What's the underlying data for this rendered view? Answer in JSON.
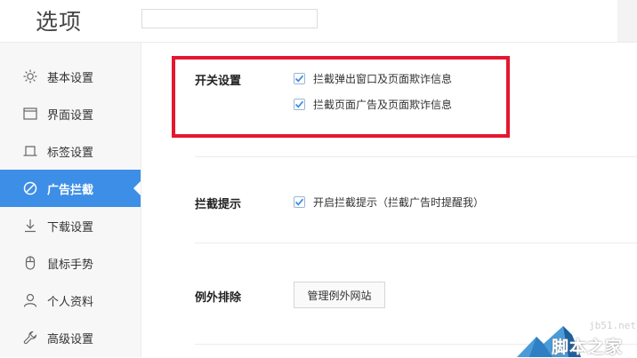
{
  "header": {
    "title": "选项",
    "search": {
      "value": "",
      "placeholder": ""
    }
  },
  "sidebar": {
    "items": [
      {
        "label": "基本设置",
        "icon": "sun-icon",
        "active": false
      },
      {
        "label": "界面设置",
        "icon": "window-icon",
        "active": false
      },
      {
        "label": "标签设置",
        "icon": "tab-icon",
        "active": false
      },
      {
        "label": "广告拦截",
        "icon": "block-icon",
        "active": true
      },
      {
        "label": "下载设置",
        "icon": "download-icon",
        "active": false
      },
      {
        "label": "鼠标手势",
        "icon": "mouse-icon",
        "active": false
      },
      {
        "label": "个人资料",
        "icon": "person-icon",
        "active": false
      },
      {
        "label": "高级设置",
        "icon": "wrench-icon",
        "active": false
      }
    ]
  },
  "main": {
    "switch_settings": {
      "label": "开关设置",
      "options": [
        {
          "label": "拦截弹出窗口及页面欺诈信息",
          "checked": true
        },
        {
          "label": "拦截页面广告及页面欺诈信息",
          "checked": true
        }
      ]
    },
    "block_tip": {
      "label": "拦截提示",
      "option": {
        "label": "开启拦截提示（拦截广告时提醒我）",
        "checked": true
      }
    },
    "exceptions": {
      "label": "例外排除",
      "button_label": "管理例外网站"
    }
  },
  "watermark": {
    "site": "jb51.net",
    "name": "脚本之家"
  },
  "colors": {
    "accent": "#3d8ee6",
    "highlight_border": "#e5172f",
    "sidebar_bg": "#f7f7f7",
    "checkbox_check": "#3d8ee6"
  }
}
